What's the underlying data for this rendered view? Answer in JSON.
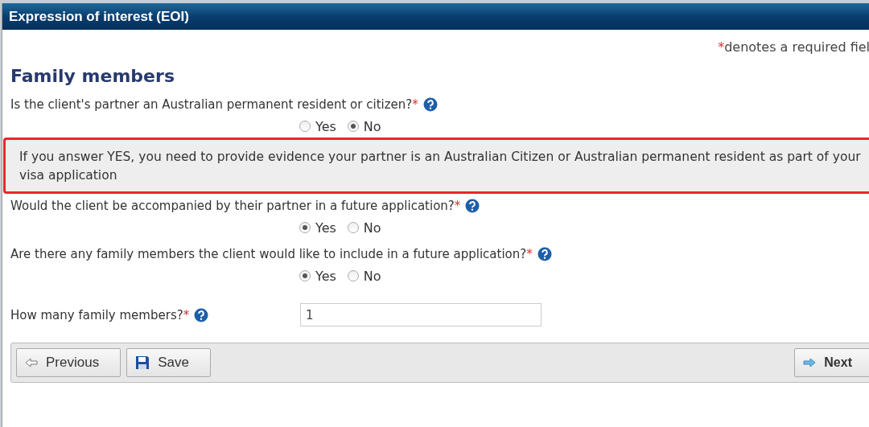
{
  "window": {
    "title": "Expression of interest (EOI)"
  },
  "required_note": {
    "mark": "*",
    "text": "denotes a required fiel"
  },
  "heading": "Family members",
  "items": [
    {
      "kind": "radio",
      "label": "Is the client's partner an Australian permanent resident or citizen?",
      "required_mark": "*",
      "options": [
        {
          "label": "Yes",
          "selected": false
        },
        {
          "label": "No",
          "selected": true
        }
      ]
    },
    {
      "kind": "notice",
      "text": "If you answer YES, you need to provide evidence your partner is an Australian Citizen or Australian permanent resident as part of your visa application"
    },
    {
      "kind": "radio",
      "label": "Would the client be accompanied by their partner in a future application?",
      "required_mark": "*",
      "options": [
        {
          "label": "Yes",
          "selected": true
        },
        {
          "label": "No",
          "selected": false
        }
      ]
    },
    {
      "kind": "radio",
      "label": "Are there any family members the client would like to include in a future application?",
      "required_mark": "*",
      "options": [
        {
          "label": "Yes",
          "selected": true
        },
        {
          "label": "No",
          "selected": false
        }
      ]
    },
    {
      "kind": "number",
      "label": "How many family members?",
      "required_mark": "*",
      "value": "1"
    }
  ],
  "buttons": [
    {
      "kind": "previous",
      "label": "Previous"
    },
    {
      "kind": "save",
      "label": "Save"
    },
    {
      "kind": "next",
      "label": "Next"
    }
  ]
}
